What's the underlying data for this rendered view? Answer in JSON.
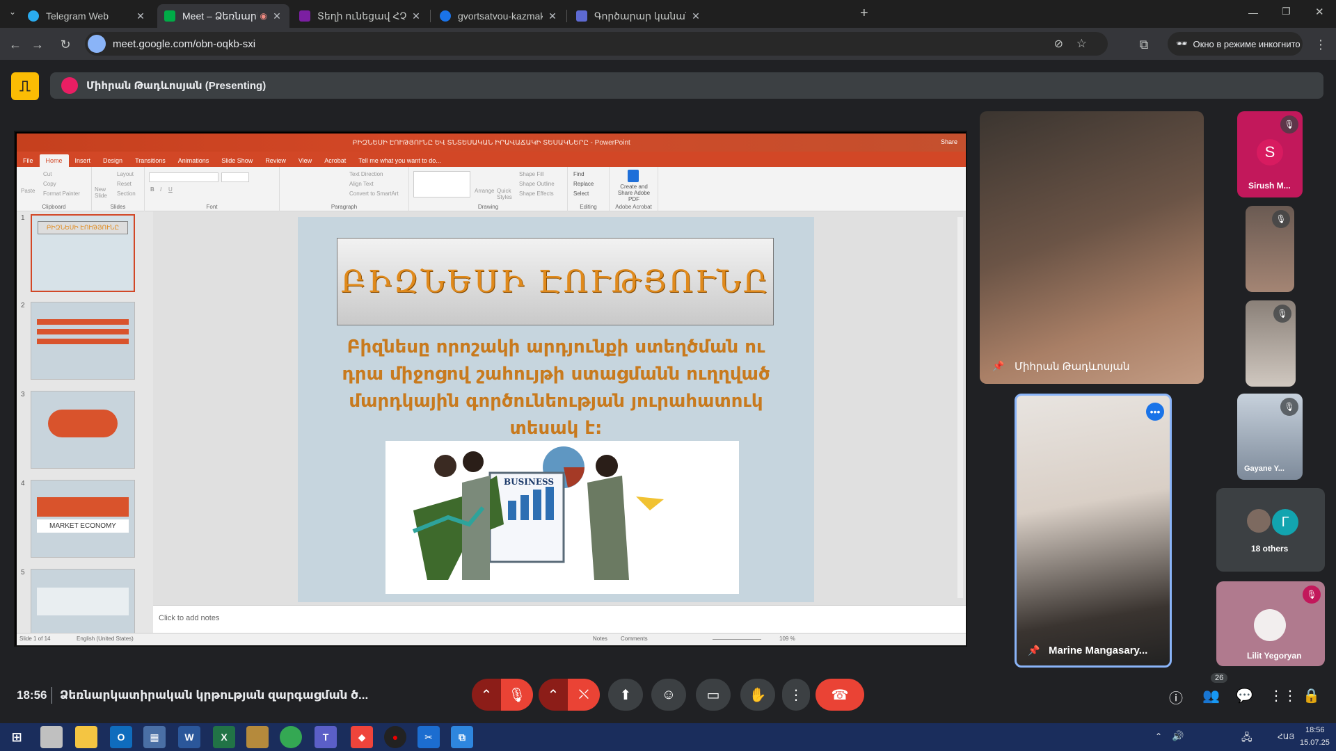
{
  "browser": {
    "tabs": [
      {
        "title": "Telegram Web",
        "color": "#2aabee"
      },
      {
        "title": "Meet – Ձեռնարկատիրակ",
        "color": "#00ac47"
      },
      {
        "title": "Տեղի ունեցավ ՀՉԱՍ խորհրդ",
        "color": "#7b1fa2"
      },
      {
        "title": "gvortsatvou-kazmakerpvouthy",
        "color": "#1a73e8"
      },
      {
        "title": "Գործարար կանանց ակումբ",
        "color": "#5e6ad2"
      }
    ],
    "new_tab": "+",
    "url": "meet.google.com/obn-oqkb-sxi",
    "incognito": "Окно в режиме инкогнито"
  },
  "meet": {
    "presenter_banner": "Միհրան Թադևոսյան (Presenting)",
    "time": "18:56",
    "meeting_title": "Ձեռնարկատիրական կրթության զարգացման ծ...",
    "people_count": "26"
  },
  "ppt": {
    "window_title": "ԲԻԶՆԵՍԻ ԷՈՒԹՅՈՒՆԸ ԵՎ ՏՆՏԵՍԱԿԱՆ ԻՐԱՎԱՃԱԿԻ ՏԵՍԱԿՆԵՐԸ - PowerPoint",
    "share": "Share",
    "tabs": [
      "File",
      "Home",
      "Insert",
      "Design",
      "Transitions",
      "Animations",
      "Slide Show",
      "Review",
      "View",
      "Acrobat",
      "Tell me what you want to do..."
    ],
    "ribbon_groups": [
      "Clipboard",
      "Slides",
      "Font",
      "Paragraph",
      "Drawing",
      "Editing",
      "Adobe Acrobat"
    ],
    "ribbon_items": {
      "paste": "Paste",
      "cut": "Cut",
      "copy": "Copy",
      "format_painter": "Format Painter",
      "new_slide": "New Slide",
      "layout": "Layout",
      "reset": "Reset",
      "section": "Section",
      "text_direction": "Text Direction",
      "align_text": "Align Text",
      "convert_smartart": "Convert to SmartArt",
      "arrange": "Arrange",
      "quick_styles": "Quick Styles",
      "shape_fill": "Shape Fill",
      "shape_outline": "Shape Outline",
      "shape_effects": "Shape Effects",
      "find": "Find",
      "replace": "Replace",
      "select": "Select",
      "create_pdf": "Create and Share Adobe PDF"
    },
    "thumbnails": [
      {
        "num": "1",
        "title": "ԲԻԶՆԵՍԻ ԷՈՒԹՅՈՒՆԸ"
      },
      {
        "num": "2",
        "title": ""
      },
      {
        "num": "3",
        "title": ""
      },
      {
        "num": "4",
        "title": "MARKET ECONOMY"
      },
      {
        "num": "5",
        "title": ""
      }
    ],
    "slide": {
      "title": "ԲԻԶՆԵՍԻ ԷՈՒԹՅՈՒՆԸ",
      "body": "Բիզնեսը որոշակի արդյունքի ստեղծման ու դրա միջոցով շահույթի ստացմանն ուղղված մարդկային գործունեության յուրահատուկ տեսակ է:",
      "image_label": "BUSINESS"
    },
    "notes_placeholder": "Click to add notes",
    "status": {
      "slide_of": "Slide 1 of 14",
      "language": "English (United States)",
      "notes": "Notes",
      "comments": "Comments",
      "zoom": "109 %"
    }
  },
  "participants": {
    "main_speaker": "Միհրան Թադևոսյան",
    "self": "Marine Mangasary...",
    "tiles": [
      {
        "name": "Sirush M...",
        "initial": "S",
        "color": "#c2185b"
      },
      {
        "name": "",
        "color": "#6a5a52"
      },
      {
        "name": "",
        "color": "#8a8078"
      },
      {
        "name": "Gayane Y...",
        "color": "#7d8a9a"
      },
      {
        "name": "Lilit Yegoryan",
        "color": "#b07a8e"
      }
    ],
    "others": {
      "label": "18 others",
      "initial": "Г",
      "color": "#12a4af"
    }
  },
  "system": {
    "time": "18:56",
    "date": "15.07.25",
    "lang": "ՀԱՅ"
  }
}
